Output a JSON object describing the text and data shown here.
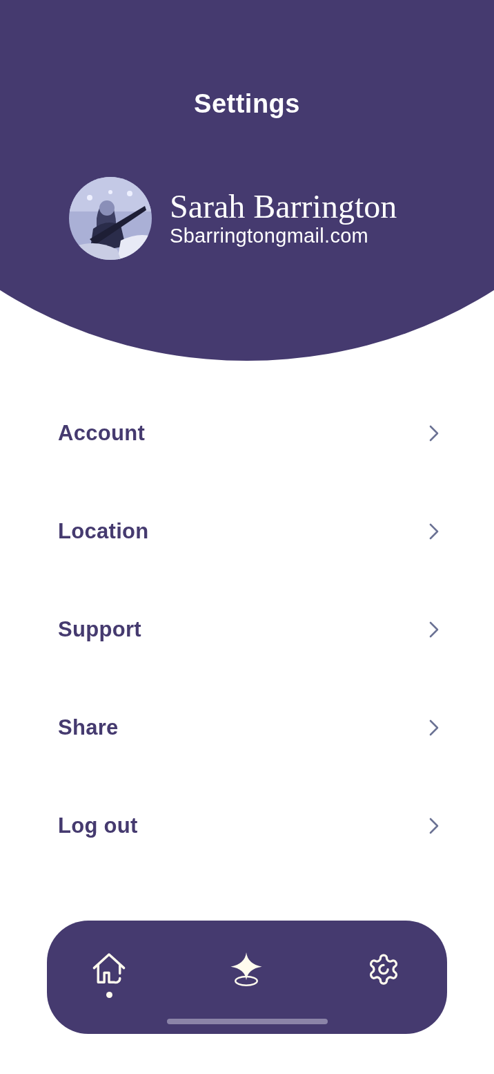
{
  "header": {
    "title": "Settings"
  },
  "profile": {
    "name": "Sarah Barrington",
    "email": "Sbarringtongmail.com"
  },
  "menu": [
    {
      "label": "Account"
    },
    {
      "label": "Location"
    },
    {
      "label": "Support"
    },
    {
      "label": "Share"
    },
    {
      "label": "Log out"
    }
  ],
  "nav": [
    {
      "kind": "home",
      "selected": true
    },
    {
      "kind": "sparkle",
      "selected": false
    },
    {
      "kind": "settings",
      "selected": false
    }
  ]
}
